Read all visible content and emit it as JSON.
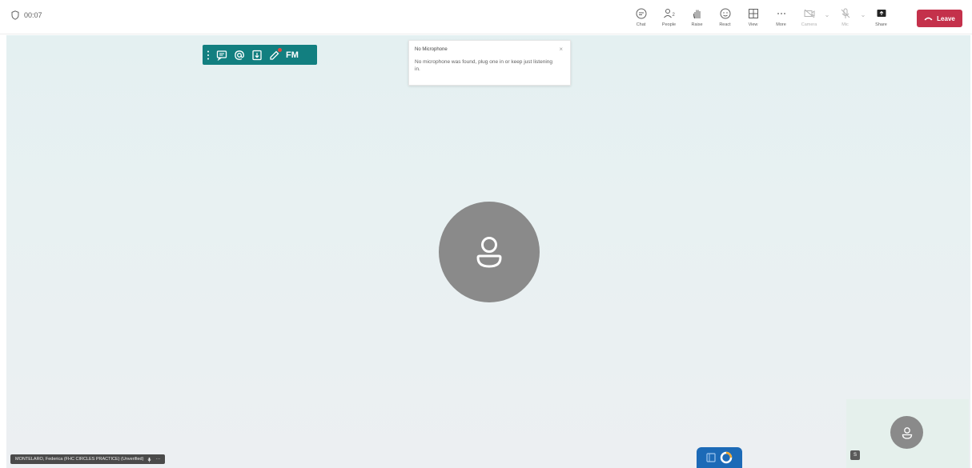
{
  "topbar": {
    "timer": "00:07",
    "controls": [
      {
        "label": "Chat",
        "icon": "chat-icon",
        "disabled": false
      },
      {
        "label": "People",
        "icon": "people-icon",
        "disabled": false
      },
      {
        "label": "Raise",
        "icon": "raise-hand-icon",
        "disabled": false
      },
      {
        "label": "React",
        "icon": "react-icon",
        "disabled": false
      },
      {
        "label": "View",
        "icon": "view-icon",
        "disabled": false
      },
      {
        "label": "More",
        "icon": "more-icon",
        "disabled": false
      },
      {
        "label": "Camera",
        "icon": "camera-icon",
        "disabled": true
      },
      {
        "label": "Mic",
        "icon": "mic-icon",
        "disabled": true
      },
      {
        "label": "Share",
        "icon": "share-icon",
        "disabled": false
      }
    ],
    "leave_label": "Leave"
  },
  "notification": {
    "title": "No Microphone",
    "body": "No microphone was found, plug one in or keep just listening in.",
    "close": "×"
  },
  "teal_toolbar": {
    "fm_label": "FM"
  },
  "participant": {
    "name_tag": "MONTELARO, Federica (FHC CIRCLES PRACTICE) (Unverified)"
  },
  "self_view": {
    "badge": "S"
  },
  "colors": {
    "accent_leave": "#c4314b",
    "teal_toolbar": "#127f80",
    "float_widget": "#1c6ab7"
  }
}
